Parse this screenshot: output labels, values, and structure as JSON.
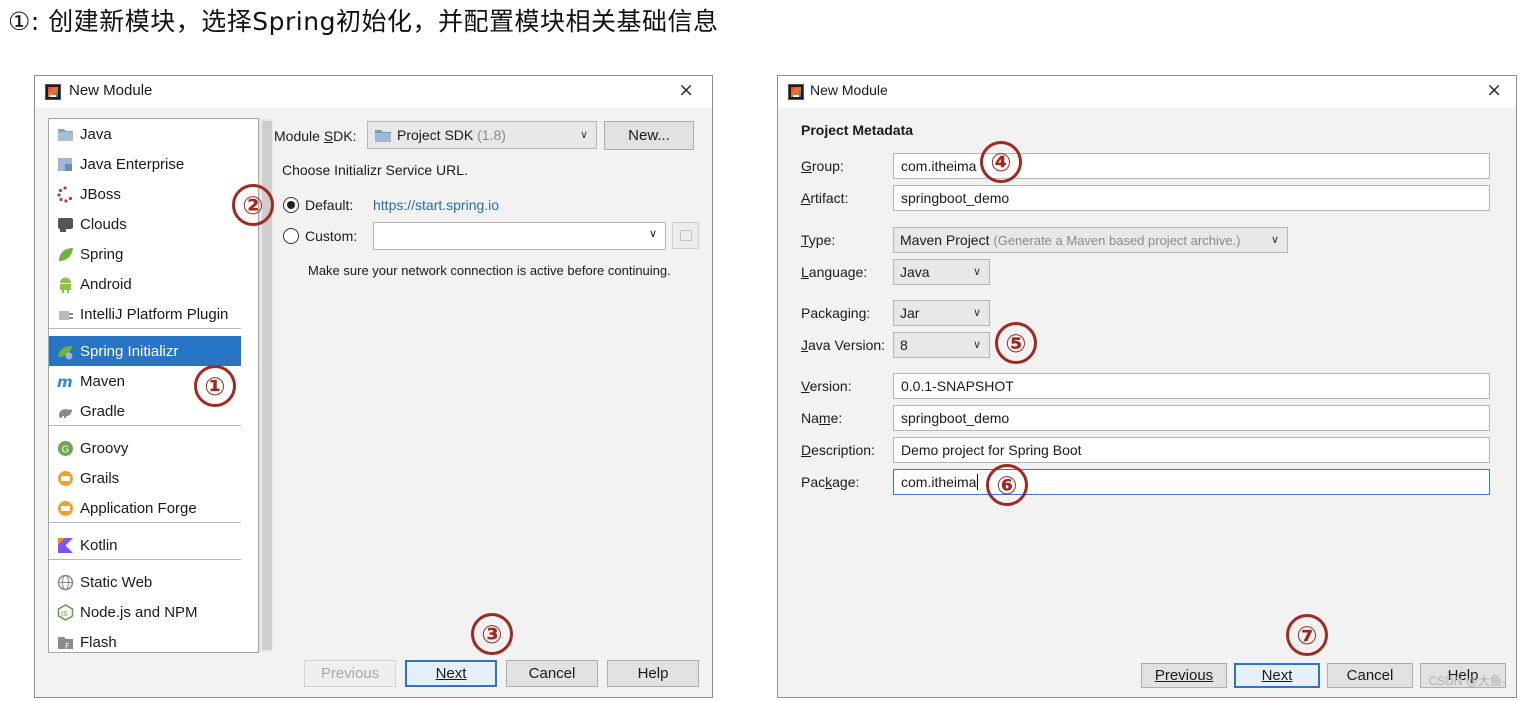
{
  "heading": "①: 创建新模块，选择Spring初始化，并配置模块相关基础信息",
  "dialog1": {
    "title": "New Module",
    "close": "×",
    "project_types": [
      {
        "label": "Java",
        "icon": "java-folder-icon"
      },
      {
        "label": "Java Enterprise",
        "icon": "java-enterprise-icon"
      },
      {
        "label": "JBoss",
        "icon": "jboss-icon"
      },
      {
        "label": "Clouds",
        "icon": "clouds-icon"
      },
      {
        "label": "Spring",
        "icon": "spring-leaf-icon"
      },
      {
        "label": "Android",
        "icon": "android-icon"
      },
      {
        "label": "IntelliJ Platform Plugin",
        "icon": "plugin-icon"
      },
      {
        "label": "Spring Initializr",
        "icon": "spring-initializr-icon",
        "selected": true
      },
      {
        "label": "Maven",
        "icon": "maven-icon"
      },
      {
        "label": "Gradle",
        "icon": "gradle-icon"
      },
      {
        "label": "Groovy",
        "icon": "groovy-icon"
      },
      {
        "label": "Grails",
        "icon": "grails-icon"
      },
      {
        "label": "Application Forge",
        "icon": "application-forge-icon"
      },
      {
        "label": "Kotlin",
        "icon": "kotlin-icon"
      },
      {
        "label": "Static Web",
        "icon": "globe-icon"
      },
      {
        "label": "Node.js and NPM",
        "icon": "nodejs-icon"
      },
      {
        "label": "Flash",
        "icon": "flash-icon"
      }
    ],
    "module_sdk_label_pre": "Module ",
    "module_sdk_label_u": "S",
    "module_sdk_label_post": "DK:",
    "sdk_value": "Project SDK",
    "sdk_hint": "(1.8)",
    "new_button": "New...",
    "service_url_label": "Choose Initializr Service URL.",
    "default_label": "Default:",
    "default_url": "https://start.spring.io",
    "custom_label": "Custom:",
    "custom_value": "",
    "network_note": "Make sure your network connection is active before continuing.",
    "buttons": {
      "previous": "Previous",
      "next": "Next",
      "cancel": "Cancel",
      "help": "Help"
    },
    "badges": [
      "①",
      "②",
      "③"
    ]
  },
  "dialog2": {
    "title": "New Module",
    "close": "×",
    "section_title": "Project Metadata",
    "fields": {
      "group": {
        "label": "Group:",
        "value": "com.itheima"
      },
      "artifact": {
        "label": "Artifact:",
        "value": "springboot_demo"
      },
      "type": {
        "label": "Type:",
        "value": "Maven Project",
        "hint": "(Generate a Maven based project archive.)"
      },
      "language": {
        "label": "Language:",
        "value": "Java"
      },
      "packaging": {
        "label": "Packaging:",
        "value": "Jar"
      },
      "java_version": {
        "label": "Java Version:",
        "value": "8"
      },
      "version": {
        "label": "Version:",
        "value": "0.0.1-SNAPSHOT"
      },
      "name": {
        "label": "Name:",
        "value": "springboot_demo"
      },
      "description": {
        "label": "Description:",
        "value": "Demo project for Spring Boot"
      },
      "package": {
        "label": "Package:",
        "value": "com.itheima"
      }
    },
    "buttons": {
      "previous": "Previous",
      "next": "Next",
      "cancel": "Cancel",
      "help": "Help"
    },
    "badges": [
      "④",
      "⑤",
      "⑥",
      "⑦"
    ],
    "watermark": "CSDN @大鱼-"
  }
}
